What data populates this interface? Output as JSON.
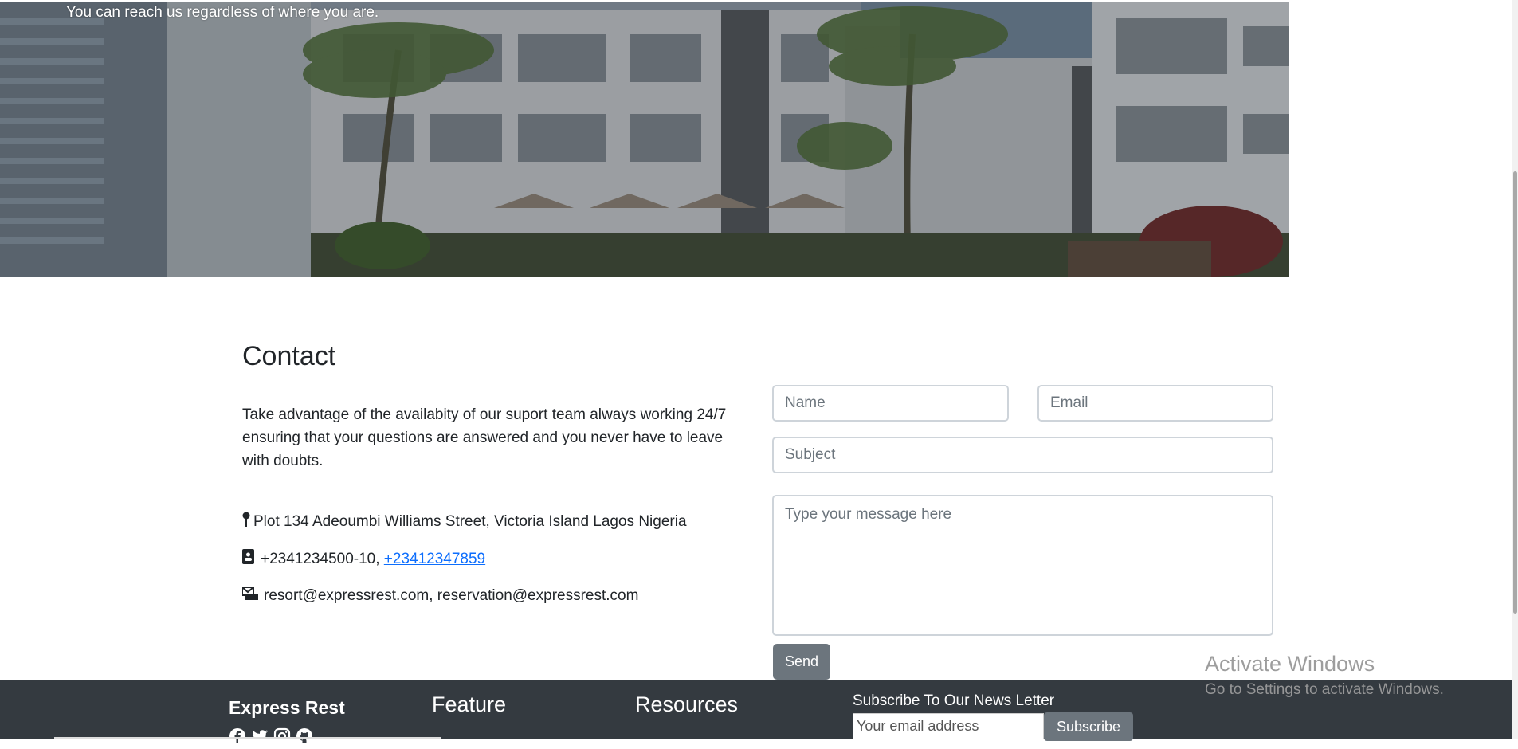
{
  "hero": {
    "tagline": "You can reach us regardless of where you are."
  },
  "contact": {
    "title": "Contact",
    "description": "Take advantage of the availabity of our suport team always working 24/7 ensuring that your questions are answered and you never have to leave with doubts.",
    "address": "Plot 134 Adeoumbi Williams Street, Victoria Island Lagos Nigeria",
    "phone_text": "+2341234500-10,",
    "phone_link": "+23412347859",
    "emails": "resort@expressrest.com, reservation@expressrest.com",
    "icons": {
      "address": "map-pin-icon",
      "phone": "phone-card-icon",
      "email": "mail-icon"
    }
  },
  "form": {
    "name_placeholder": "Name",
    "email_placeholder": "Email",
    "subject_placeholder": "Subject",
    "message_placeholder": "Type your message here",
    "send_label": "Send"
  },
  "footer": {
    "brand": "Express Rest",
    "social_icons": [
      "facebook-icon",
      "twitter-icon",
      "instagram-icon",
      "github-icon"
    ],
    "feature_heading": "Feature",
    "resources_heading": "Resources",
    "newsletter_title": "Subscribe To Our News Letter",
    "newsletter_placeholder": "Your email address",
    "subscribe_label": "Subscribe"
  },
  "watermark": {
    "line1": "Activate Windows",
    "line2": "Go to Settings to activate Windows."
  },
  "colors": {
    "footer_bg": "#343a40",
    "button_bg": "#6c757d",
    "link": "#0d6efd"
  }
}
